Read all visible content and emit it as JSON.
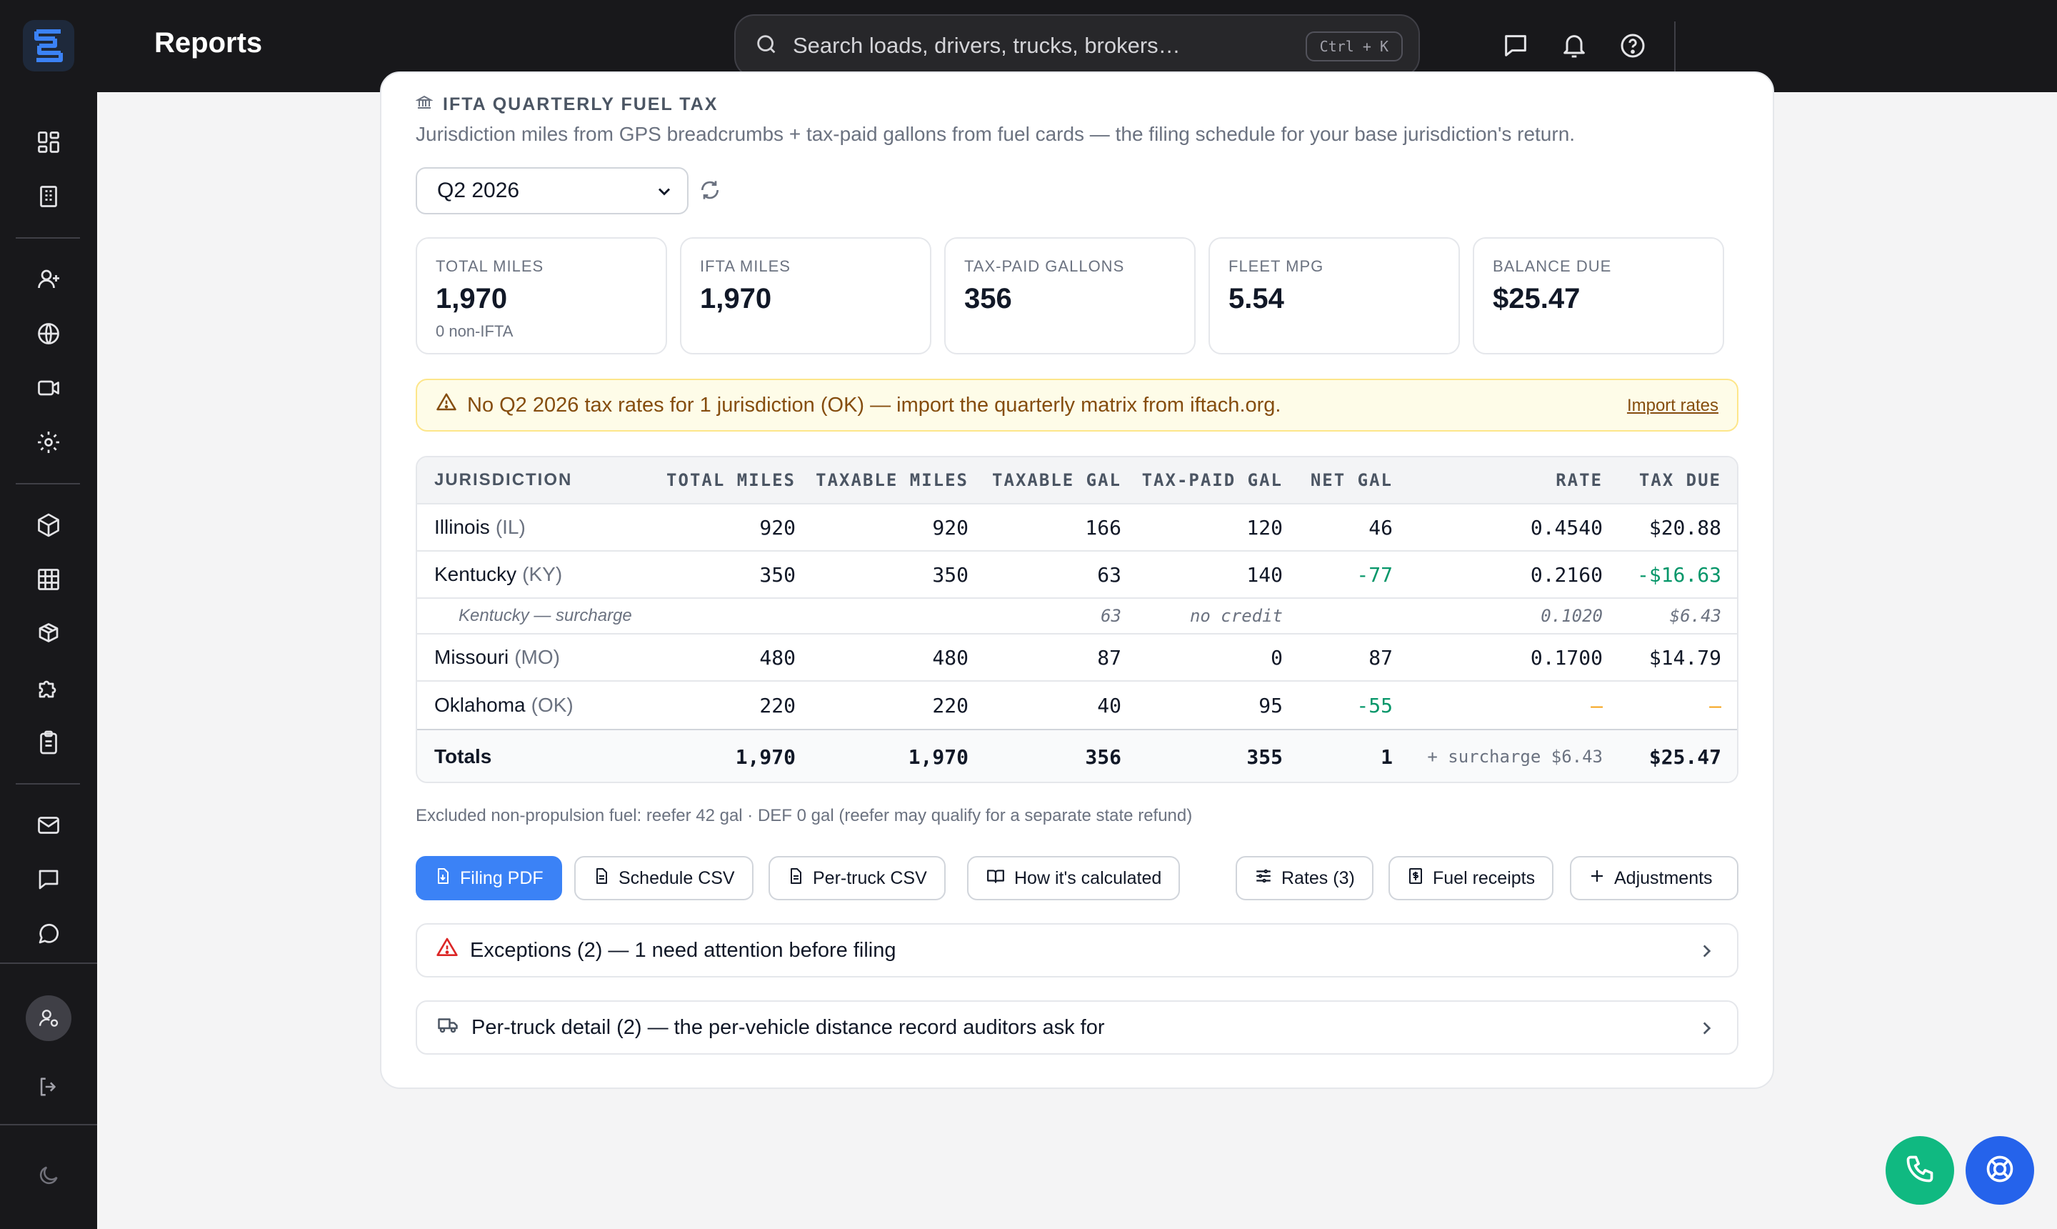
{
  "app": {
    "page_title": "Reports"
  },
  "search": {
    "placeholder": "Search loads, drivers, trucks, brokers…",
    "shortcut": "Ctrl + K"
  },
  "section": {
    "title": "IFTA QUARTERLY FUEL TAX",
    "description": "Jurisdiction miles from GPS breadcrumbs + tax-paid gallons from fuel cards — the filing schedule for your base jurisdiction's return."
  },
  "quarter": {
    "selected": "Q2 2026"
  },
  "stats": [
    {
      "label": "TOTAL MILES",
      "value": "1,970",
      "sub": "0 non-IFTA"
    },
    {
      "label": "IFTA MILES",
      "value": "1,970"
    },
    {
      "label": "TAX-PAID GALLONS",
      "value": "356"
    },
    {
      "label": "FLEET MPG",
      "value": "5.54"
    },
    {
      "label": "BALANCE DUE",
      "value": "$25.47"
    }
  ],
  "warning": {
    "text": "No Q2 2026 tax rates for 1 jurisdiction (OK) — import the quarterly matrix from iftach.org.",
    "link": "Import rates"
  },
  "table": {
    "headers": [
      "JURISDICTION",
      "TOTAL MILES",
      "TAXABLE MILES",
      "TAXABLE GAL",
      "TAX-PAID GAL",
      "NET GAL",
      "RATE",
      "TAX DUE"
    ],
    "rows": [
      {
        "name": "Illinois",
        "abbr": "(IL)",
        "total_miles": "920",
        "taxable_miles": "920",
        "taxable_gal": "166",
        "tax_paid_gal": "120",
        "net_gal": "46",
        "rate": "0.4540",
        "tax_due": "$20.88"
      },
      {
        "name": "Kentucky",
        "abbr": "(KY)",
        "total_miles": "350",
        "taxable_miles": "350",
        "taxable_gal": "63",
        "tax_paid_gal": "140",
        "net_gal": "-77",
        "rate": "0.2160",
        "tax_due": "-$16.63"
      },
      {
        "name": "Kentucky — surcharge",
        "taxable_gal": "63",
        "tax_paid_gal": "no credit",
        "rate": "0.1020",
        "tax_due": "$6.43"
      },
      {
        "name": "Missouri",
        "abbr": "(MO)",
        "total_miles": "480",
        "taxable_miles": "480",
        "taxable_gal": "87",
        "tax_paid_gal": "0",
        "net_gal": "87",
        "rate": "0.1700",
        "tax_due": "$14.79"
      },
      {
        "name": "Oklahoma",
        "abbr": "(OK)",
        "total_miles": "220",
        "taxable_miles": "220",
        "taxable_gal": "40",
        "tax_paid_gal": "95",
        "net_gal": "-55",
        "rate": "—",
        "tax_due": "—"
      }
    ],
    "totals": {
      "label": "Totals",
      "total_miles": "1,970",
      "taxable_miles": "1,970",
      "taxable_gal": "356",
      "tax_paid_gal": "355",
      "net_gal": "1",
      "surcharge": "+ surcharge $6.43",
      "tax_due": "$25.47"
    }
  },
  "excluded_note": "Excluded non-propulsion fuel: reefer 42 gal · DEF 0 gal (reefer may qualify for a separate state refund)",
  "buttons": {
    "filing_pdf": "Filing PDF",
    "schedule_csv": "Schedule CSV",
    "per_truck_csv": "Per-truck CSV",
    "how_calculated": "How it's calculated",
    "rates": "Rates (3)",
    "fuel_receipts": "Fuel receipts",
    "adjustments": "Adjustments"
  },
  "panels": {
    "exceptions": "Exceptions (2) — 1 need attention before filing",
    "per_truck": "Per-truck detail (2) — the per-vehicle distance record auditors ask for"
  },
  "colors": {
    "accent": "#3b82f6",
    "negative": "#059669",
    "warning_bg": "#fefce8",
    "call_fab": "#10b981",
    "support_fab": "#2563eb"
  },
  "icons": [
    "logo-icon",
    "search-icon",
    "chat-icon",
    "bell-icon",
    "help-icon",
    "dashboard-icon",
    "building-icon",
    "user-plus-icon",
    "globe-icon",
    "video-icon",
    "gear-icon",
    "package-icon",
    "grid-icon",
    "boxes-icon",
    "puzzle-icon",
    "clipboard-icon",
    "mail-icon",
    "message-square-icon",
    "message-circle-icon",
    "user-settings-icon",
    "logout-icon",
    "moon-icon",
    "phone-icon",
    "lifebuoy-icon"
  ]
}
